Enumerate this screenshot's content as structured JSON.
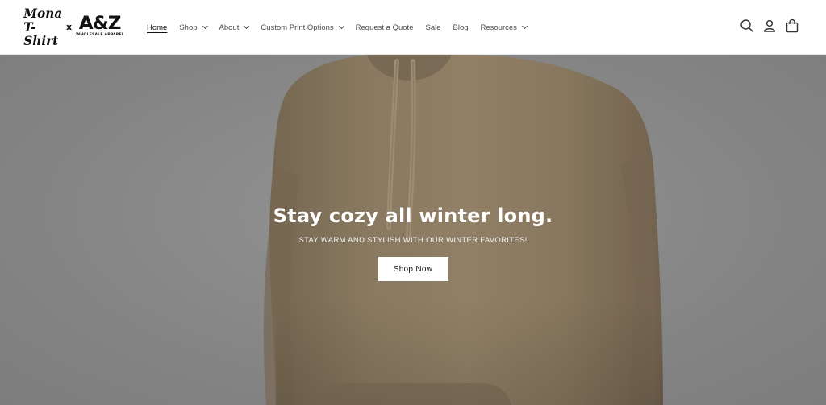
{
  "logo": {
    "script_line1": "Mona",
    "script_line2": "T-Shirt",
    "separator": "x",
    "brand": "A&Z",
    "brand_tagline": "WHOLESALE APPAREL"
  },
  "nav": {
    "items": [
      {
        "label": "Home",
        "active": true,
        "dropdown": false
      },
      {
        "label": "Shop",
        "active": false,
        "dropdown": true
      },
      {
        "label": "About",
        "active": false,
        "dropdown": true
      },
      {
        "label": "Custom Print Options",
        "active": false,
        "dropdown": true
      },
      {
        "label": "Request a Quote",
        "active": false,
        "dropdown": false
      },
      {
        "label": "Sale",
        "active": false,
        "dropdown": false
      },
      {
        "label": "Blog",
        "active": false,
        "dropdown": false
      },
      {
        "label": "Resources",
        "active": false,
        "dropdown": true
      }
    ]
  },
  "header_icons": [
    "search-icon",
    "account-icon",
    "cart-icon"
  ],
  "hero": {
    "title": "Stay cozy all winter long.",
    "subtitle": "STAY WARM AND STYLISH WITH OUR WINTER FAVORITES!",
    "button_label": "Shop Now"
  },
  "colors": {
    "hero_background": "#8f8f8f",
    "hoodie": "#8d7c63",
    "text_dark": "#121212",
    "button_bg": "#ffffff"
  }
}
